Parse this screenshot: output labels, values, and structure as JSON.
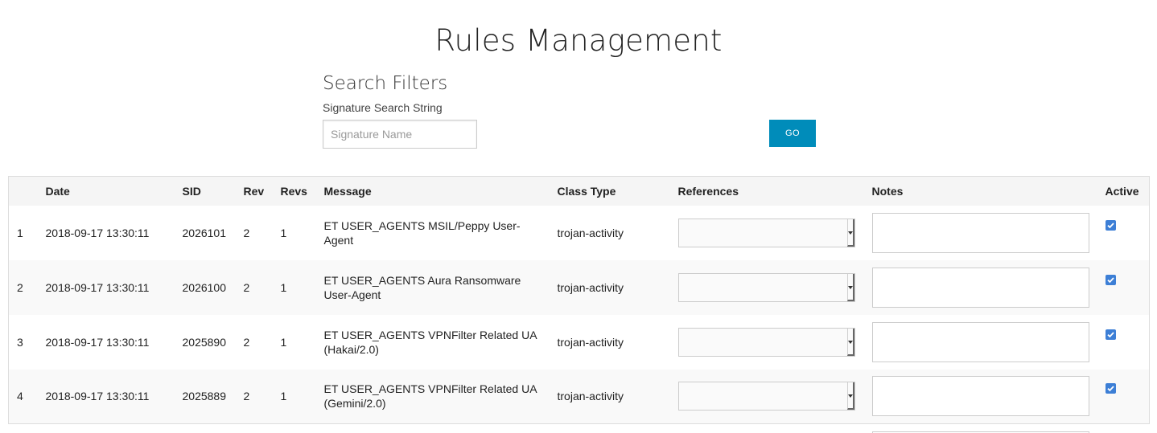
{
  "page": {
    "title": "Rules Management"
  },
  "search": {
    "section_title": "Search Filters",
    "label": "Signature Search String",
    "placeholder": "Signature Name",
    "value": "",
    "go_label": "GO"
  },
  "colors": {
    "go_button": "#008cba",
    "checkbox": "#3d7fd6",
    "header_bg": "#f5f5f5",
    "stripe_bg": "#f9f9f9"
  },
  "table": {
    "headers": {
      "index": "",
      "date": "Date",
      "sid": "SID",
      "rev": "Rev",
      "revs": "Revs",
      "message": "Message",
      "class_type": "Class Type",
      "references": "References",
      "notes": "Notes",
      "active": "Active"
    },
    "rows": [
      {
        "index": "1",
        "date": "2018-09-17 13:30:11",
        "sid": "2026101",
        "rev": "2",
        "revs": "1",
        "message": "ET USER_AGENTS MSIL/Peppy User-Agent",
        "class_type": "trojan-activity",
        "references": "",
        "notes": "",
        "active": true
      },
      {
        "index": "2",
        "date": "2018-09-17 13:30:11",
        "sid": "2026100",
        "rev": "2",
        "revs": "1",
        "message": "ET USER_AGENTS Aura Ransomware User-Agent",
        "class_type": "trojan-activity",
        "references": "",
        "notes": "",
        "active": true
      },
      {
        "index": "3",
        "date": "2018-09-17 13:30:11",
        "sid": "2025890",
        "rev": "2",
        "revs": "1",
        "message": "ET USER_AGENTS VPNFilter Related UA (Hakai/2.0)",
        "class_type": "trojan-activity",
        "references": "",
        "notes": "",
        "active": true
      },
      {
        "index": "4",
        "date": "2018-09-17 13:30:11",
        "sid": "2025889",
        "rev": "2",
        "revs": "1",
        "message": "ET USER_AGENTS VPNFilter Related UA (Gemini/2.0)",
        "class_type": "trojan-activity",
        "references": "",
        "notes": "",
        "active": true
      }
    ]
  }
}
